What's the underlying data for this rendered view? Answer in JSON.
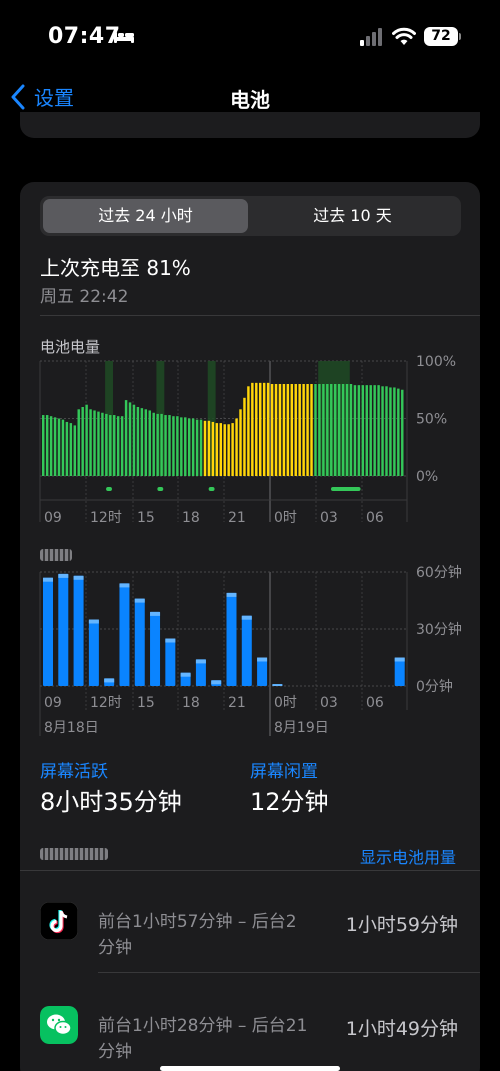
{
  "status": {
    "time": "07:47",
    "battery": "72"
  },
  "nav": {
    "back_label": "设置",
    "title": "电池"
  },
  "segment": {
    "options": [
      "过去 24 小时",
      "过去 10 天"
    ],
    "selected": 0
  },
  "last_charge": {
    "title": "上次充电至 81%",
    "date": "周五 22:42"
  },
  "battery_chart": {
    "label": "电池电量",
    "y_ticks": [
      "100%",
      "50%",
      "0%"
    ],
    "x_ticks": [
      "09",
      "12时",
      "15",
      "18",
      "21",
      "0时",
      "03",
      "06"
    ]
  },
  "activity_chart": {
    "y_ticks": [
      "60分钟",
      "30分钟",
      "0分钟"
    ],
    "x_ticks": [
      "09",
      "12时",
      "15",
      "18",
      "21",
      "0时",
      "03",
      "06"
    ],
    "dates": [
      "8月18日",
      "8月19日"
    ]
  },
  "stats": {
    "active_label": "屏幕活跃",
    "active_value": "8小时35分钟",
    "idle_label": "屏幕闲置",
    "idle_value": "12分钟"
  },
  "usage": {
    "show_link": "显示电池用量"
  },
  "apps": [
    {
      "icon": "tiktok-icon",
      "desc": "前台1小时57分钟 – 后台2分钟",
      "total": "1小时59分钟"
    },
    {
      "icon": "wechat-icon",
      "desc": "前台1小时28分钟 – 后台21分钟",
      "total": "1小时49分钟"
    }
  ],
  "colors": {
    "accent": "#1a86ff",
    "battery_green": "#34c759",
    "low_power_yellow": "#ffd60a",
    "bar_blue": "#0a84ff"
  },
  "chart_data": [
    {
      "type": "bar",
      "title": "电池电量",
      "unit": "%",
      "ylim": [
        0,
        100
      ],
      "x_ticks": [
        "09",
        "12时",
        "15",
        "18",
        "21",
        "0时",
        "03",
        "06"
      ],
      "values": [
        53,
        53,
        52,
        51,
        50,
        49,
        47,
        46,
        44,
        58,
        60,
        62,
        58,
        57,
        56,
        55,
        54,
        53,
        53,
        52,
        52,
        66,
        64,
        62,
        60,
        59,
        58,
        57,
        55,
        54,
        54,
        53,
        53,
        52,
        52,
        51,
        51,
        50,
        50,
        49,
        49,
        48,
        48,
        47,
        46,
        46,
        45,
        45,
        46,
        50,
        58,
        68,
        78,
        81,
        81,
        81,
        81,
        81,
        80,
        80,
        80,
        80,
        80,
        80,
        80,
        80,
        80,
        80,
        80,
        80,
        80,
        80,
        80,
        80,
        80,
        80,
        80,
        80,
        80,
        79,
        79,
        79,
        79,
        79,
        79,
        79,
        78,
        78,
        77,
        77,
        76,
        75
      ],
      "low_power": {
        "start": 41,
        "end": 68
      },
      "charging_ranges": [
        [
          16,
          17
        ],
        [
          29,
          30
        ],
        [
          42,
          43
        ],
        [
          70,
          77
        ]
      ]
    },
    {
      "type": "bar",
      "title": "",
      "unit": "分钟",
      "ylim": [
        0,
        60
      ],
      "x_ticks": [
        "09",
        "12时",
        "15",
        "18",
        "21",
        "0时",
        "03",
        "06"
      ],
      "dates": [
        "8月18日",
        "8月19日"
      ],
      "values": [
        57,
        59,
        58,
        35,
        4,
        54,
        46,
        39,
        25,
        7,
        14,
        3,
        49,
        37,
        15,
        1,
        0,
        0,
        0,
        0,
        0,
        0,
        0,
        15
      ]
    }
  ]
}
